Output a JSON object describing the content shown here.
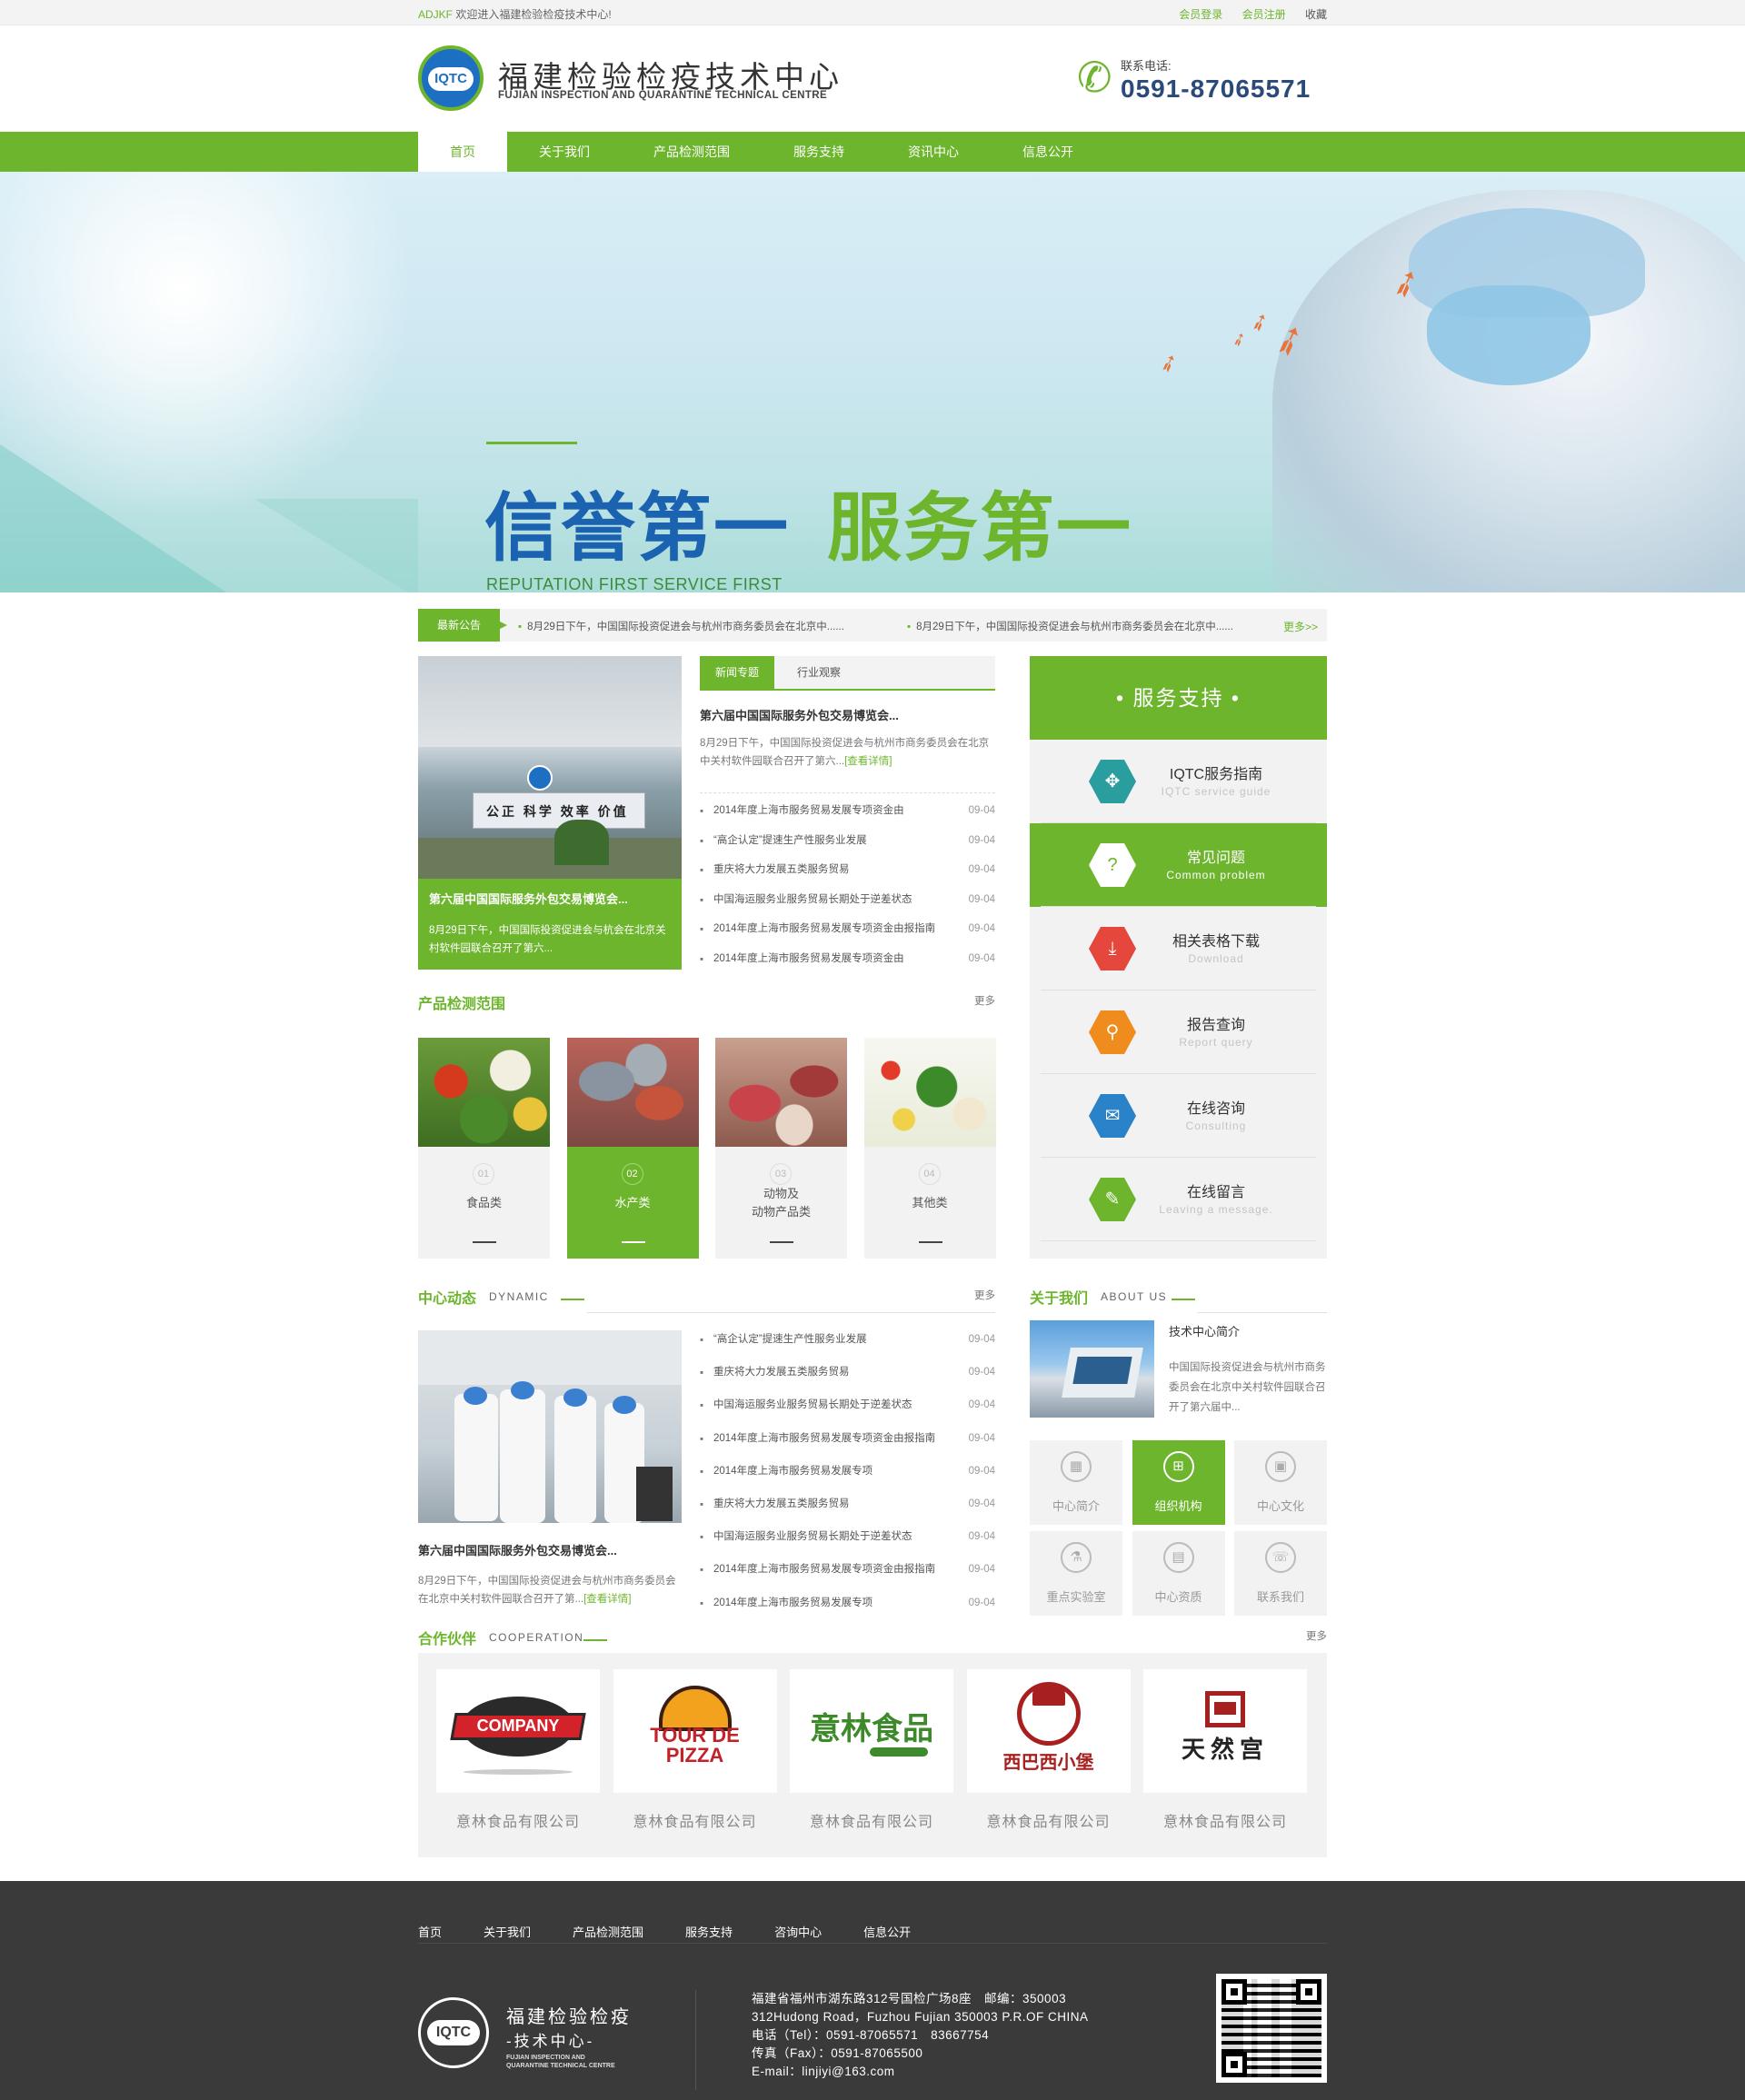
{
  "topbar": {
    "prefix": "ADJKF",
    "welcome": "欢迎进入福建检验检疫技术中心!",
    "login": "会员登录",
    "register": "会员注册",
    "favorite": "收藏"
  },
  "header": {
    "logo_mark": "IQTC",
    "title_cn": "福建检验检疫技术中心",
    "title_en": "FUJIAN INSPECTION AND QUARANTINE TECHNICAL CENTRE",
    "phone_label": "联系电话:",
    "phone": "0591-87065571"
  },
  "nav": [
    "首页",
    "关于我们",
    "产品检测范围",
    "服务支持",
    "资讯中心",
    "信息公开"
  ],
  "banner": {
    "title1": "信誉第一",
    "title2": "服务第一",
    "subtitle": "REPUTATION FIRST SERVICE FIRST",
    "active_slide": 3,
    "slides": 4
  },
  "notice": {
    "tag": "最新公告",
    "items": [
      "8月29日下午，中国国际投资促进会与杭州市商务委员会在北京中......",
      "8月29日下午，中国国际投资促进会与杭州市商务委员会在北京中......"
    ],
    "more": "更多>>"
  },
  "feature": {
    "sign": "公正 科学 效率 价值",
    "title": "第六届中国国际服务外包交易博览会...",
    "desc": "8月29日下午，中国国际投资促进会与杭会在北京关村软件园联合召开了第六..."
  },
  "news": {
    "tabs": [
      "新闻专题",
      "行业观察"
    ],
    "head": "第六届中国国际服务外包交易博览会...",
    "intro": "8月29日下午，中国国际投资促进会与杭州市商务委员会在北京中关村软件园联合召开了第六...",
    "detail": "[查看详情]",
    "items": [
      {
        "t": "2014年度上海市服务贸易发展专项资金由",
        "d": "09-04"
      },
      {
        "t": "“高企认定”提速生产性服务业发展",
        "d": "09-04"
      },
      {
        "t": "重庆将大力发展五类服务贸易",
        "d": "09-04"
      },
      {
        "t": "中国海运服务业服务贸易长期处于逆差状态",
        "d": "09-04"
      },
      {
        "t": "2014年度上海市服务贸易发展专项资金由报指南",
        "d": "09-04"
      },
      {
        "t": "2014年度上海市服务贸易发展专项资金由",
        "d": "09-04"
      }
    ]
  },
  "service": {
    "title": "• 服务支持 •",
    "items": [
      {
        "cn": "IQTC服务指南",
        "en": "IQTC service guide",
        "icon": "compass-icon",
        "color": "#2a9d9f",
        "glyph": "✥"
      },
      {
        "cn": "常见问题",
        "en": "Common problem",
        "icon": "question-user-icon",
        "color": "#6db52d",
        "glyph": "?"
      },
      {
        "cn": "相关表格下载",
        "en": "Download",
        "icon": "download-icon",
        "color": "#e5473c",
        "glyph": "⤓"
      },
      {
        "cn": "报告查询",
        "en": "Report query",
        "icon": "search-icon",
        "color": "#f08c1e",
        "glyph": "⚲"
      },
      {
        "cn": "在线咨询",
        "en": "Consulting",
        "icon": "chat-icon",
        "color": "#2a82c8",
        "glyph": "✉"
      },
      {
        "cn": "在线留言",
        "en": "Leaving a message.",
        "icon": "message-icon",
        "color": "#6db52d",
        "glyph": "✎"
      }
    ],
    "active": 1
  },
  "products": {
    "title": "产品检测范围",
    "more": "更多",
    "items": [
      {
        "no": "01",
        "name": "食品类"
      },
      {
        "no": "02",
        "name": "水产类"
      },
      {
        "no": "03",
        "name": "动物及\n动物产品类"
      },
      {
        "no": "04",
        "name": "其他类"
      }
    ],
    "active": 1
  },
  "dynamic": {
    "title": "中心动态",
    "en": "DYNAMIC",
    "more": "更多",
    "ph_title": "第六届中国国际服务外包交易博览会...",
    "ph_desc": "8月29日下午，中国国际投资促进会与杭州市商务委员会在北京中关村软件园联合召开了第...",
    "detail": "[查看详情]",
    "items": [
      {
        "t": "“高企认定”提速生产性服务业发展",
        "d": "09-04"
      },
      {
        "t": "重庆将大力发展五类服务贸易",
        "d": "09-04"
      },
      {
        "t": "中国海运服务业服务贸易长期处于逆差状态",
        "d": "09-04"
      },
      {
        "t": "2014年度上海市服务贸易发展专项资金由报指南",
        "d": "09-04"
      },
      {
        "t": "2014年度上海市服务贸易发展专项",
        "d": "09-04"
      },
      {
        "t": "重庆将大力发展五类服务贸易",
        "d": "09-04"
      },
      {
        "t": "中国海运服务业服务贸易长期处于逆差状态",
        "d": "09-04"
      },
      {
        "t": "2014年度上海市服务贸易发展专项资金由报指南",
        "d": "09-04"
      },
      {
        "t": "2014年度上海市服务贸易发展专项",
        "d": "09-04"
      }
    ]
  },
  "about": {
    "title": "关于我们",
    "en": "ABOUT US",
    "head": "技术中心简介",
    "desc": "中国国际投资促进会与杭州市商务委员会在北京中关村软件园联合召开了第六届中...",
    "grid": [
      {
        "label": "中心简介",
        "icon": "building-icon",
        "glyph": "▦"
      },
      {
        "label": "组织机构",
        "icon": "org-chart-icon",
        "glyph": "⊞"
      },
      {
        "label": "中心文化",
        "icon": "book-icon",
        "glyph": "▣"
      },
      {
        "label": "重点实验室",
        "icon": "flask-icon",
        "glyph": "⚗"
      },
      {
        "label": "中心资质",
        "icon": "certificate-icon",
        "glyph": "▤"
      },
      {
        "label": "联系我们",
        "icon": "phone-icon",
        "glyph": "☏"
      }
    ],
    "active": 1
  },
  "partners": {
    "title": "合作伙伴",
    "en": "COOPERATION",
    "more": "更多",
    "items": [
      {
        "name": "意林食品有限公司",
        "logo_text": "COMPANY",
        "icon": "company-logo-icon"
      },
      {
        "name": "意林食品有限公司",
        "logo_text": "TOUR DE PIZZA",
        "icon": "pizza-logo-icon"
      },
      {
        "name": "意林食品有限公司",
        "logo_text": "意林食品",
        "icon": "yilin-logo-icon"
      },
      {
        "name": "意林食品有限公司",
        "logo_text": "西巴西小堡",
        "icon": "chef-logo-icon"
      },
      {
        "name": "意林食品有限公司",
        "logo_text": "天然宫",
        "icon": "palace-logo-icon"
      }
    ]
  },
  "footer": {
    "nav": [
      "首页",
      "关于我们",
      "产品检测范围",
      "服务支持",
      "咨询中心",
      "信息公开"
    ],
    "logo_mark": "IQTC",
    "cn1": "福建检验检疫",
    "cn2": "-技术中心-",
    "en": "FUJIAN INSPECTION AND QUARANTINE TECHNICAL CENTRE",
    "address": [
      "福建省福州市湖东路312号国检广场8座　邮编：350003",
      "312Hudong Road，Fuzhou Fujian 350003 P.R.OF CHINA",
      "电话（Tel）：0591-87065571　83667754",
      "传真（Fax）：0591-87065500",
      "E-mail：linjiyi@163.com"
    ]
  },
  "colors": {
    "accent": "#6db52d",
    "brand_blue": "#1b63b0",
    "footer": "#3a3a3a"
  }
}
